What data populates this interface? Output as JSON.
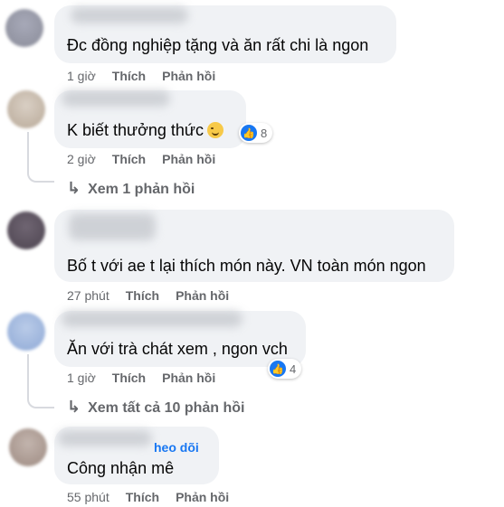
{
  "colors": {
    "bubble": "#f0f2f5",
    "like": "#1877f2",
    "meta": "#65676b"
  },
  "comments": [
    {
      "text": "Đc đồng nghiệp tặng và ăn rất chi là ngon",
      "time": "1 giờ",
      "like": "Thích",
      "reply": "Phản hồi"
    },
    {
      "text": "K biết thưởng thức",
      "emoji": "smirk-emoji",
      "time": "2 giờ",
      "like": "Thích",
      "reply": "Phản hồi",
      "reactions": "8",
      "view_replies": "Xem 1 phản hồi"
    },
    {
      "text": "Bố t với ae t lại thích món này. VN toàn món ngon",
      "time": "27 phút",
      "like": "Thích",
      "reply": "Phản hồi"
    },
    {
      "text": "Ăn với trà chát xem , ngon vch",
      "time": "1 giờ",
      "like": "Thích",
      "reply": "Phản hồi",
      "reactions": "4",
      "view_replies": "Xem tất cả 10 phản hồi"
    },
    {
      "text": "Công nhận mê",
      "follow": "heo dõi",
      "time": "55 phút",
      "like": "Thích",
      "reply": "Phản hồi"
    }
  ]
}
